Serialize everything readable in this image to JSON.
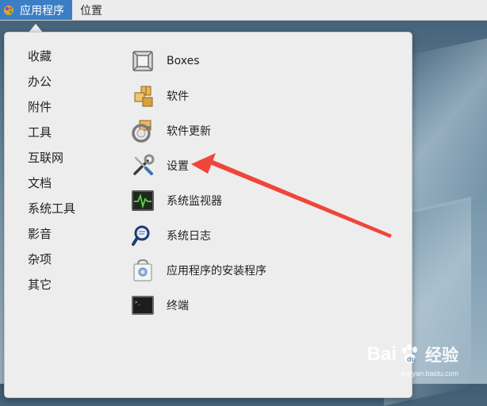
{
  "top_bar": {
    "apps_label": "应用程序",
    "places_label": "位置"
  },
  "categories": [
    {
      "label": "收藏"
    },
    {
      "label": "办公"
    },
    {
      "label": "附件"
    },
    {
      "label": "工具"
    },
    {
      "label": "互联网"
    },
    {
      "label": "文档"
    },
    {
      "label": "系统工具"
    },
    {
      "label": "影音"
    },
    {
      "label": "杂项"
    },
    {
      "label": "其它"
    }
  ],
  "apps": [
    {
      "label": "Boxes",
      "icon": "boxes-icon"
    },
    {
      "label": "软件",
      "icon": "software-icon"
    },
    {
      "label": "软件更新",
      "icon": "software-update-icon"
    },
    {
      "label": "设置",
      "icon": "settings-tools-icon"
    },
    {
      "label": "系统监视器",
      "icon": "system-monitor-icon"
    },
    {
      "label": "系统日志",
      "icon": "system-log-icon"
    },
    {
      "label": "应用程序的安装程序",
      "icon": "app-installer-icon"
    },
    {
      "label": "终端",
      "icon": "terminal-icon"
    }
  ],
  "annotation": {
    "color": "#f0453a"
  },
  "watermark": {
    "brand_left": "Bai",
    "brand_right": "经验",
    "url": "jingyan.baidu.com"
  }
}
